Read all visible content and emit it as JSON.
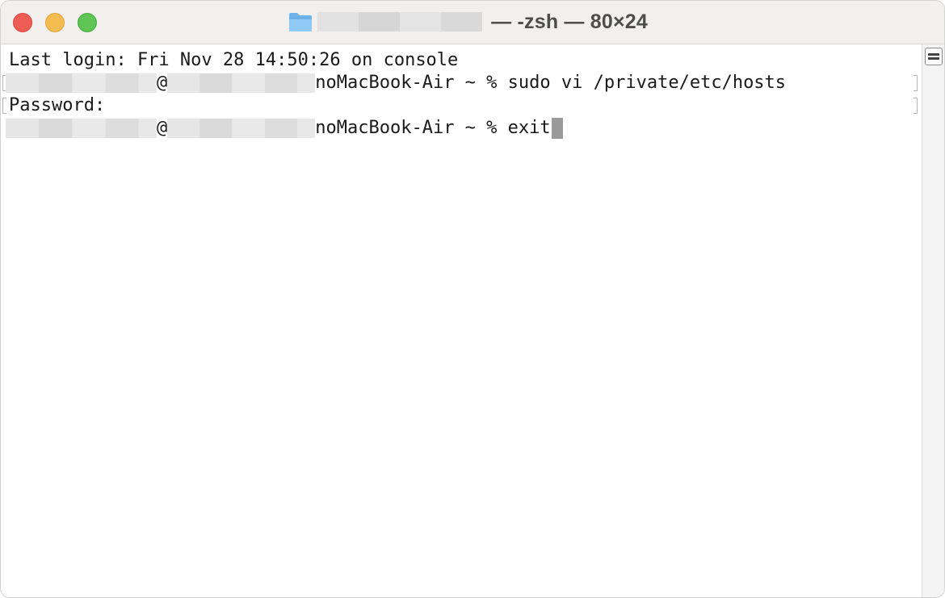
{
  "window": {
    "title_suffix": " — -zsh — 80×24"
  },
  "terminal": {
    "line1": "Last login: Fri Nov 28 14:50:26 on console",
    "at_symbol": "@",
    "host_suffix": "noMacBook-Air ~ % ",
    "line2_command": "sudo vi /private/etc/hosts",
    "line3": "Password:",
    "line4_command": "exit"
  }
}
